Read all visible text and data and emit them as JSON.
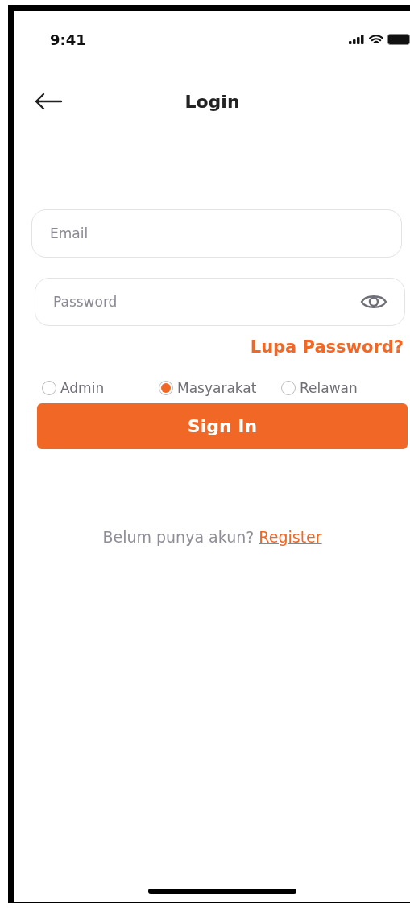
{
  "status_bar": {
    "time": "9:41"
  },
  "header": {
    "title": "Login"
  },
  "email_field": {
    "placeholder": "Email"
  },
  "password_field": {
    "placeholder": "Password"
  },
  "forgot_link": "Lupa Password?",
  "roles": [
    {
      "label": "Admin",
      "selected": false
    },
    {
      "label": "Masyarakat",
      "selected": true
    },
    {
      "label": "Relawan",
      "selected": false
    }
  ],
  "sign_in_button": "Sign In",
  "register_prompt": {
    "text": "Belum punya akun?",
    "link": "Register"
  }
}
